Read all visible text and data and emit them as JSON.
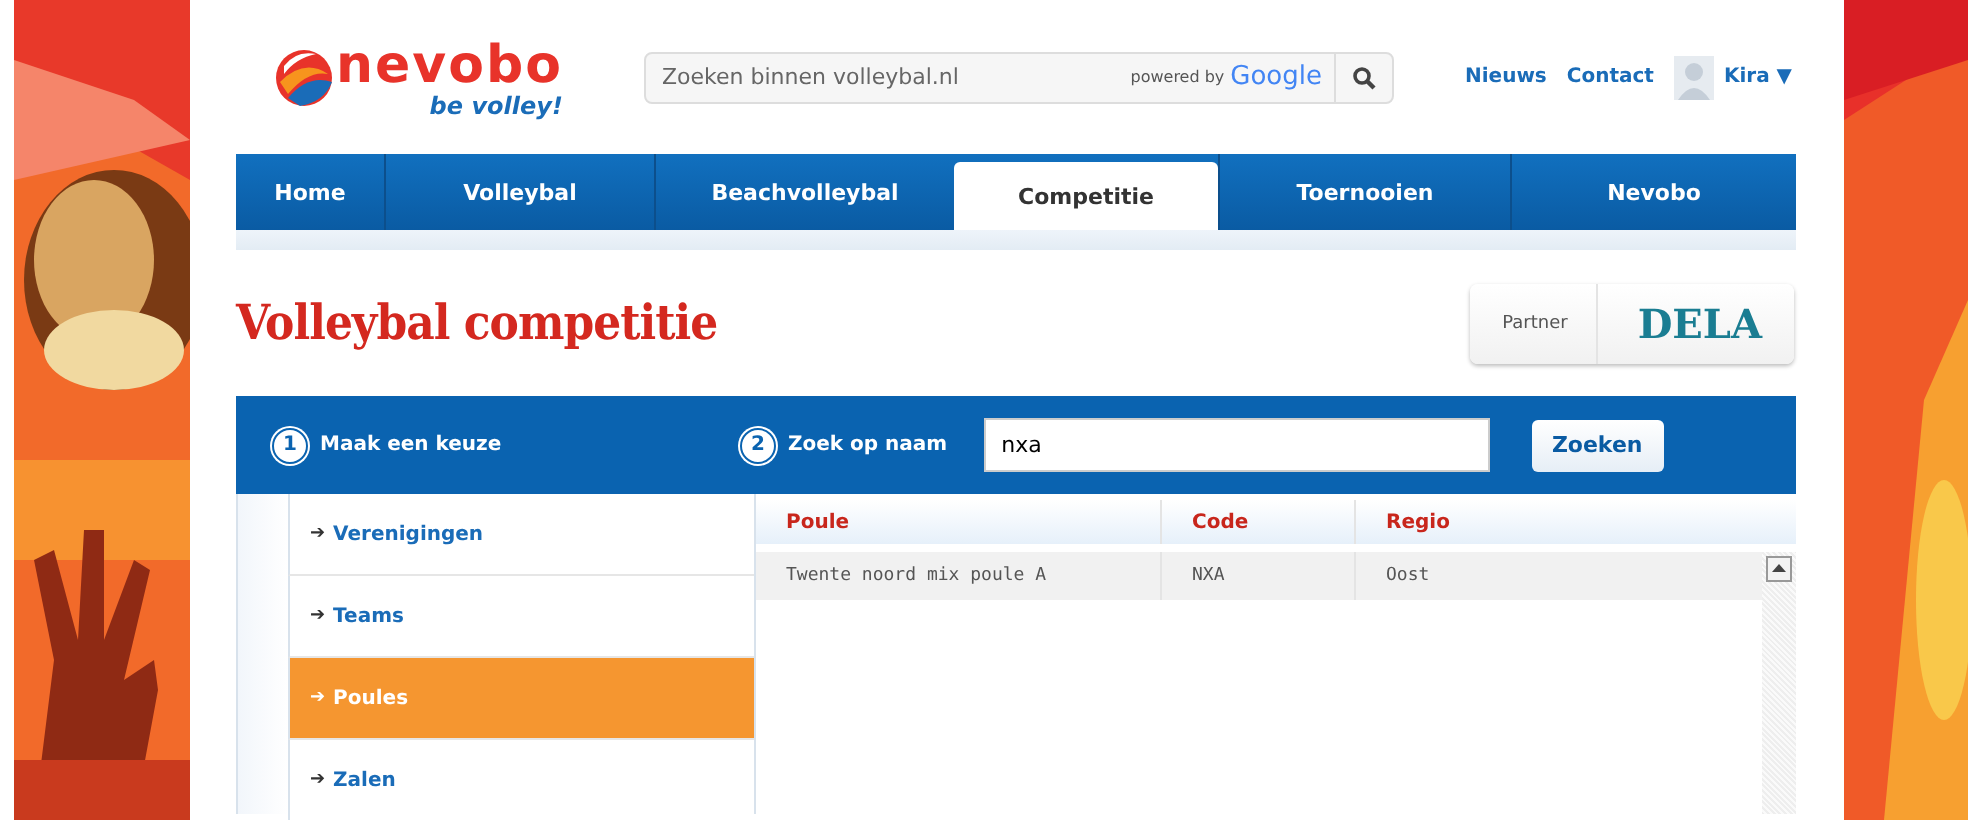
{
  "header": {
    "logo": {
      "name": "nevobo",
      "slogan": "be volley!"
    },
    "search": {
      "placeholder": "Zoeken binnen volleybal.nl",
      "powered_by": "powered by",
      "provider": "Google"
    },
    "links": [
      "Nieuws",
      "Contact"
    ],
    "user": {
      "name": "Kira",
      "caret": "▼"
    }
  },
  "nav": {
    "tabs": [
      {
        "label": "Home",
        "selected": false
      },
      {
        "label": "Volleybal",
        "selected": false
      },
      {
        "label": "Beachvolleybal",
        "selected": false
      },
      {
        "label": "Competitie",
        "selected": true
      },
      {
        "label": "Toernooien",
        "selected": false
      },
      {
        "label": "Nevobo",
        "selected": false
      }
    ]
  },
  "page_title": "Volleybal competitie",
  "partner": {
    "label": "Partner",
    "name": "DELA"
  },
  "panel": {
    "steps": [
      {
        "number": "1",
        "label": "Maak een keuze"
      },
      {
        "number": "2",
        "label": "Zoek op naam"
      }
    ],
    "search": {
      "value": "nxa",
      "button": "Zoeken"
    },
    "menu": [
      {
        "arrow": "➔",
        "label": "Verenigingen",
        "selected": false
      },
      {
        "arrow": "➔",
        "label": "Teams",
        "selected": false
      },
      {
        "arrow": "➔",
        "label": "Poules",
        "selected": true
      },
      {
        "arrow": "➔",
        "label": "Zalen",
        "selected": false
      }
    ],
    "table": {
      "columns": [
        "Poule",
        "Code",
        "Regio"
      ],
      "rows": [
        [
          "Twente noord mix poule A",
          "NXA",
          "Oost"
        ]
      ]
    }
  }
}
